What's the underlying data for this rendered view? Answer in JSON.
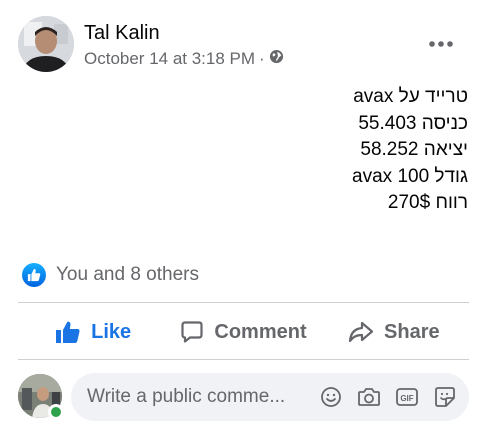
{
  "post": {
    "author": "Tal Kalin",
    "timestamp": "October 14 at 3:18 PM",
    "separator": "·",
    "privacy_icon": "globe-icon",
    "more_icon": "more-horizontal-icon",
    "body_lines": [
      "טרייד על avax",
      "כניסה 55.403",
      "יציאה 58.252",
      "גודל 100 avax",
      "רווח 270$"
    ]
  },
  "reactions": {
    "icon": "like-reaction-icon",
    "summary": "You and 8 others"
  },
  "actions": {
    "like_label": "Like",
    "comment_label": "Comment",
    "share_label": "Share"
  },
  "comment_box": {
    "placeholder": "Write a public comme...",
    "value": "",
    "icons": [
      "emoji-icon",
      "camera-icon",
      "gif-icon",
      "sticker-icon"
    ]
  },
  "colors": {
    "accent": "#1b74e4",
    "secondary_text": "#65676b",
    "online": "#31a24c",
    "input_bg": "#f0f2f5"
  }
}
